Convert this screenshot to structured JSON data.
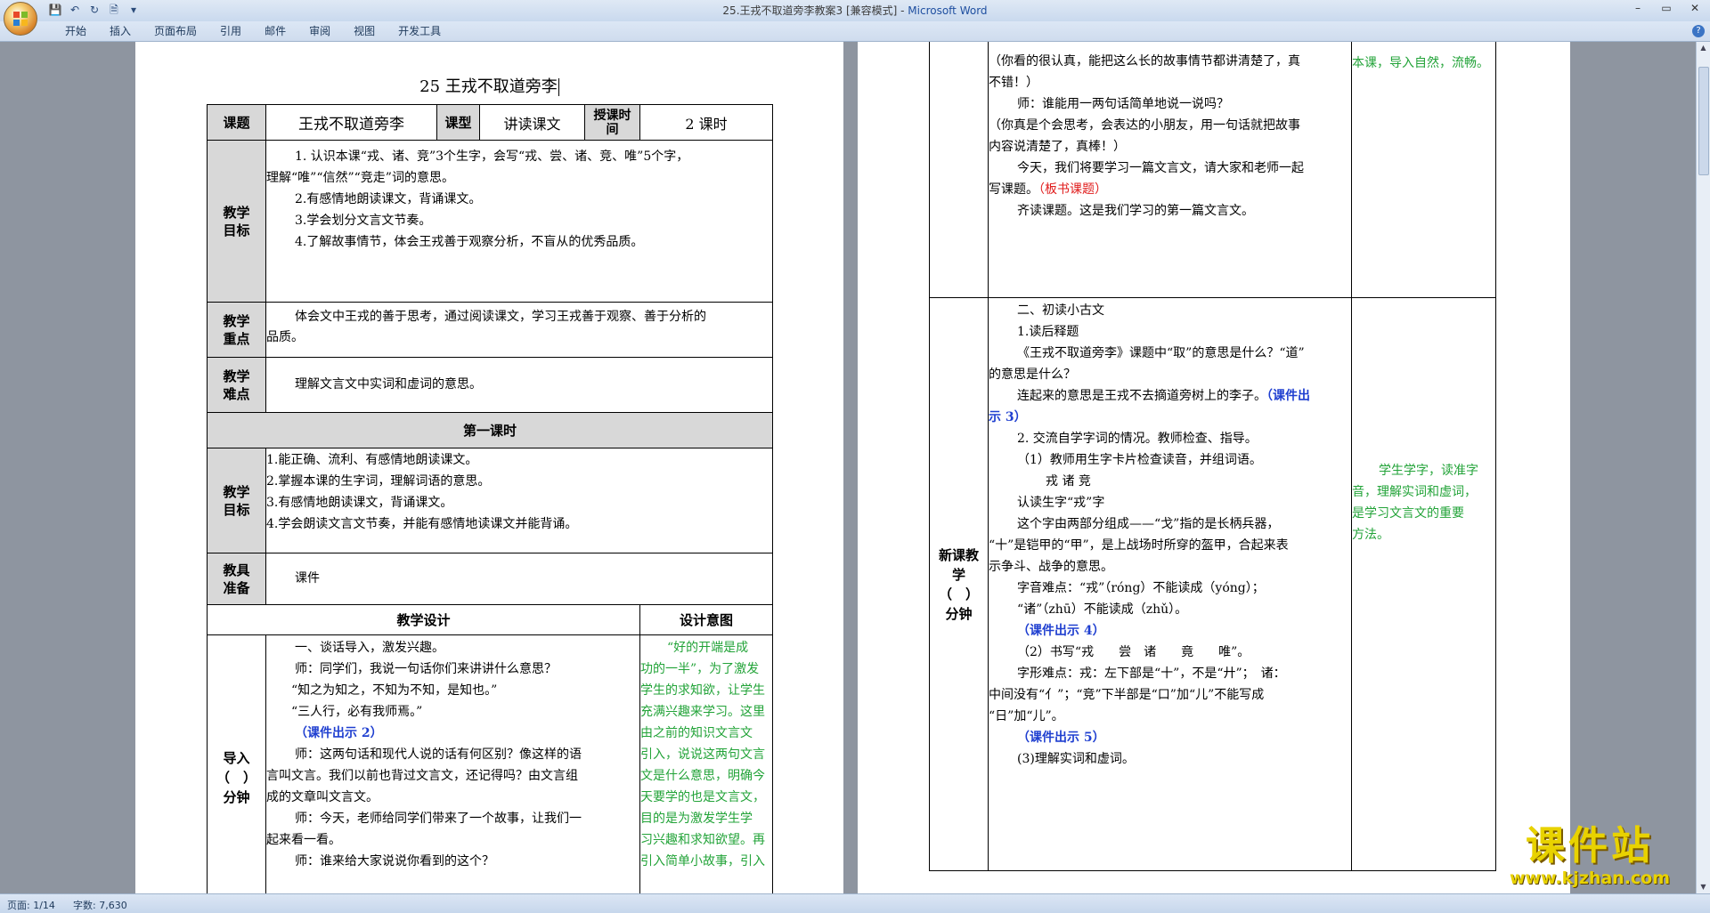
{
  "window": {
    "title": "25.王戎不取道旁李教案3 [兼容模式] - ",
    "app": "Microsoft Word"
  },
  "ribbon": {
    "tabs": [
      "开始",
      "插入",
      "页面布局",
      "引用",
      "邮件",
      "审阅",
      "视图",
      "开发工具"
    ]
  },
  "status": {
    "page": "页面: 1/14",
    "words": "字数: 7,630"
  },
  "watermark": {
    "text": "课件站",
    "url": "www.kjzhan.com"
  },
  "left_page": {
    "title": "25 王戎不取道旁李",
    "header": {
      "topic_label": "课题",
      "topic": "王戎不取道旁李",
      "type_label": "课型",
      "type": "讲读课文",
      "time_label": "授课时间",
      "time": "2 课时"
    },
    "goals_label": "教学目标",
    "goals": [
      "1. 认识本课“戎、诸、竞”3个生字，会写“戎、尝、诸、竞、唯”5个字，",
      "理解“唯”“信然”“竞走”词的意思。",
      "2.有感情地朗读课文，背诵课文。",
      "3.学会划分文言文节奏。",
      "4.了解故事情节，体会王戎善于观察分析，不盲从的优秀品质。"
    ],
    "key_label": "教学重点",
    "key": [
      "体会文中王戎的善于思考，通过阅读课文，学习王戎善于观察、善于分析的",
      "品质。"
    ],
    "diff_label": "教学难点",
    "diff": "理解文言文中实词和虚词的意思。",
    "lesson1": "第一课时",
    "goals2_label": "教学目标",
    "goals2": [
      "1.能正确、流利、有感情地朗读课文。",
      "2.掌握本课的生字词，理解词语的意思。",
      "3.有感情地朗读课文，背诵课文。",
      "4.学会朗读文言文节奏，并能有感情地读课文并能背诵。"
    ],
    "prep_label": "教具准备",
    "prep": "课件",
    "design_label": "教学设计",
    "intent_label": "设计意图",
    "intro_label": "导入（　）分钟",
    "intro_lines": [
      "一、谈话导入，激发兴趣。",
      "师：同学们，我说一句话你们来讲讲什么意思？",
      "“知之为知之，不知为不知，是知也。”",
      "“三人行，必有我师焉。”",
      "（课件出示 2）",
      "师：这两句话和现代人说的话有何区别？像这样的语",
      "言叫文言。我们以前也背过文言文，还记得吗？由文言组",
      "成的文章叫文言文。",
      "师：今天，老师给同学们带来了一个故事，让我们一",
      "起来看一看。",
      "师：谁来给大家说说你看到的这个？"
    ],
    "intro_intent": [
      "“好的开端是成",
      "功的一半”，为了激发",
      "学生的求知欲，让学生",
      "充满兴趣来学习。这里",
      "由之前的知识文言文",
      "引入，说说这两句文言",
      "文是什么意思，明确今",
      "天要学的也是文言文，",
      "目的是为激发学生学",
      "习兴趣和求知欲望。再",
      "引入简单小故事，引入"
    ]
  },
  "right_page": {
    "top_lines": [
      "（你看的很认真，能把这么长的故事情节都讲清楚了，真",
      "不错！）",
      "师：谁能用一两句话简单地说一说吗？",
      "（你真是个会思考，会表达的小朋友，用一句话就把故事",
      "内容说清楚了，真棒！）",
      "今天，我们将要学习一篇文言文，请大家和老师一起",
      "写课题。",
      "（板书课题）",
      "齐读课题。这是我们学习的第一篇文言文。"
    ],
    "top_intent": "本课，导入自然，流畅。",
    "new_label": "新课教学（　）分钟",
    "new_lines": [
      "二、初读小古文",
      "1.读后释题",
      "《王戎不取道旁李》课题中“取”的意思是什么？“道”",
      "的意思是什么？",
      "连起来的意思是王戎不去摘道旁树上的李子。",
      "（课件出",
      "示 3）",
      "2. 交流自学字词的情况。教师检查、指导。",
      "（1）教师用生字卡片检查读音，并组词语。",
      "戎 诸 竞",
      "认读生字“戎”字",
      "这个字由两部分组成——“戈”指的是长柄兵器，",
      "“十”是铠甲的“甲”，是上战场时所穿的盔甲，合起来表",
      "示争斗、战争的意思。",
      "字音难点：“戎”（róng）不能读成（yóng）；",
      "“诸”（zhū）不能读成（zhǔ）。",
      "（课件出示 4）",
      "（2）书写“戎　　尝　诸　　竟　　唯”。",
      "字形难点：戎：左下部是“十”，不是“廾”；　诸：",
      "中间没有“亻”；“竞”下半部是“口”加“儿”不能写成",
      "“日”加“儿”。",
      "（课件出示 5）",
      "(3)理解实词和虚词。"
    ],
    "new_intent": [
      "学生学字，读准字",
      "音，理解实词和虚词，",
      "是学习文言文的重要",
      "方法。"
    ]
  }
}
